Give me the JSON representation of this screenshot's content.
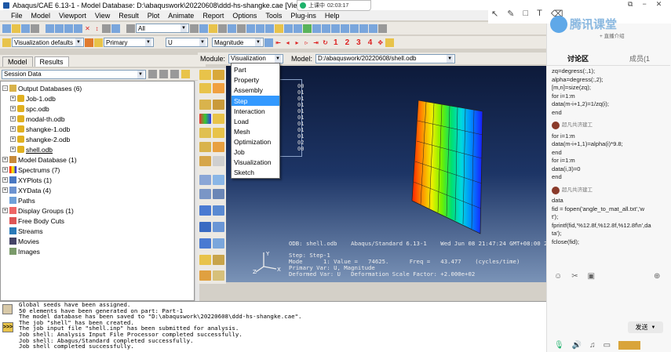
{
  "titlebar": {
    "title": "Abaqus/CAE 6.13-1 - Model Database: D:\\abaquswork\\20220608\\ddd-hs-shangke.cae [Viewport: 1]"
  },
  "recording": {
    "status": "上课中",
    "time": "02:03:17"
  },
  "menubar": [
    "File",
    "Model",
    "Viewport",
    "View",
    "Result",
    "Plot",
    "Animate",
    "Report",
    "Options",
    "Tools",
    "Plug-ins",
    "Help"
  ],
  "toolbar": {
    "display_group": "All",
    "viz_defaults": "Visualization defaults",
    "primary": "Primary",
    "variable": "U",
    "component": "Magnitude",
    "frame_numbers": [
      "1",
      "2",
      "3",
      "4"
    ]
  },
  "tabs": {
    "model": "Model",
    "results": "Results"
  },
  "session": {
    "label": "Session Data"
  },
  "tree": {
    "output_databases": "Output Databases (6)",
    "odbs": [
      "Job-1.odb",
      "spc.odb",
      "modal-th.odb",
      "shangke-1.odb",
      "shangke-2.odb",
      "shell.odb"
    ],
    "others": [
      "Model Database (1)",
      "Spectrums (7)",
      "XYPlots (1)",
      "XYData (4)",
      "Paths",
      "Display Groups (1)",
      "Free Body Cuts",
      "Streams",
      "Movies",
      "Images"
    ]
  },
  "modbar": {
    "module_label": "Module:",
    "module_value": "Visualization",
    "model_label": "Model:",
    "model_value": "D:/abaquswork/20220608/shell.odb"
  },
  "module_menu": {
    "items": [
      "Part",
      "Property",
      "Assembly",
      "Step",
      "Interaction",
      "Load",
      "Mesh",
      "Optimization",
      "Job",
      "Visualization",
      "Sketch"
    ],
    "highlighted": "Step"
  },
  "legend": {
    "values": [
      "00",
      "01",
      "01",
      "01",
      "01",
      "01",
      "01",
      "01",
      "01",
      "02",
      "00"
    ]
  },
  "viewport_info": {
    "odb_line": "ODB: shell.odb    Abaqus/Standard 6.13-1    Wed Jun 08 21:47:24 GMT+08:00 2022",
    "step_line": "Step: Step-1",
    "mode_line": "Mode      1: Value =   74625.      Freq =   43.477    (cycles/time)",
    "primary_line": "Primary Var: U, Magnitude",
    "deformed_line": "Deformed Var: U   Deformation Scale Factor: +2.000e+02"
  },
  "messages": [
    "Global seeds have been assigned.",
    "50 elements have been generated on part: Part-1",
    "The model database has been saved to \"D:\\abaquswork\\20220608\\ddd-hs-shangke.cae\".",
    "The job \"shell\" has been created.",
    "The job input file \"shell.inp\" has been submitted for analysis.",
    "Job shell: Analysis Input File Processor completed successfully.",
    "Job shell: Abaqus/Standard completed successfully.",
    "Job shell completed successfully."
  ],
  "right_panel": {
    "brand": "腾讯课堂",
    "brand_sub": "+ 直播介绍",
    "tab_discuss": "讨论区",
    "tab_members": "成员(1",
    "code_top": [
      "zq=degress(:,1);",
      "alpha=degress(:,2);",
      "[m,n]=size(zq);",
      "for i=1:m",
      "data(m-i+1,2)=1/zq(i);",
      "end"
    ],
    "user": "超凡共济建工",
    "code_mid": [
      "for i=1:m",
      "data(m-i+1,1)=alpha(i)*9.8;",
      "end",
      "for i=1:m",
      "data(i,3)=0",
      "end"
    ],
    "code_bottom": [
      "data",
      "fid = fopen('angle_to_mat_all.txt','w",
      "t');",
      "fprintf(fid,'%12.8f,%12.8f,%12.8f\\n',da",
      "ta');",
      "fclose(fid);"
    ],
    "send": "发送"
  }
}
